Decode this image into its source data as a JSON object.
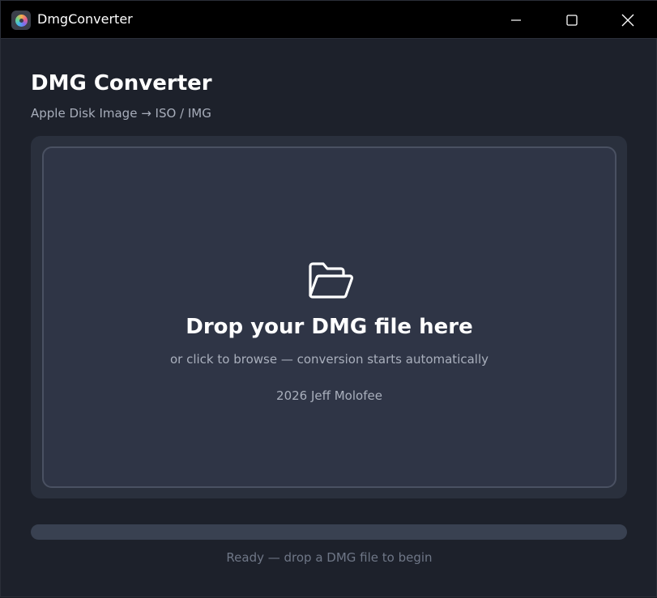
{
  "window": {
    "title": "DmgConverter",
    "icons": {
      "app": "disc-app-icon",
      "minimize": "minimize-icon",
      "maximize": "maximize-icon",
      "close": "close-icon"
    }
  },
  "header": {
    "title": "DMG Converter",
    "subtitle": "Apple Disk Image → ISO / IMG"
  },
  "drop_zone": {
    "icon": "folder-open-icon",
    "heading": "Drop your DMG file here",
    "hint": "or click to browse  —  conversion starts automatically",
    "credit": "2026 Jeff Molofee"
  },
  "progress": {
    "value": 0
  },
  "status": {
    "text": "Ready — drop a DMG file to begin"
  },
  "colors": {
    "background": "#1d212b",
    "titlebar": "#000000",
    "drop_zone": "#2f3546",
    "drop_border": "#4a5162",
    "progress_track": "#394151",
    "accent": "#5b8def",
    "status_text": "#6f7787"
  }
}
